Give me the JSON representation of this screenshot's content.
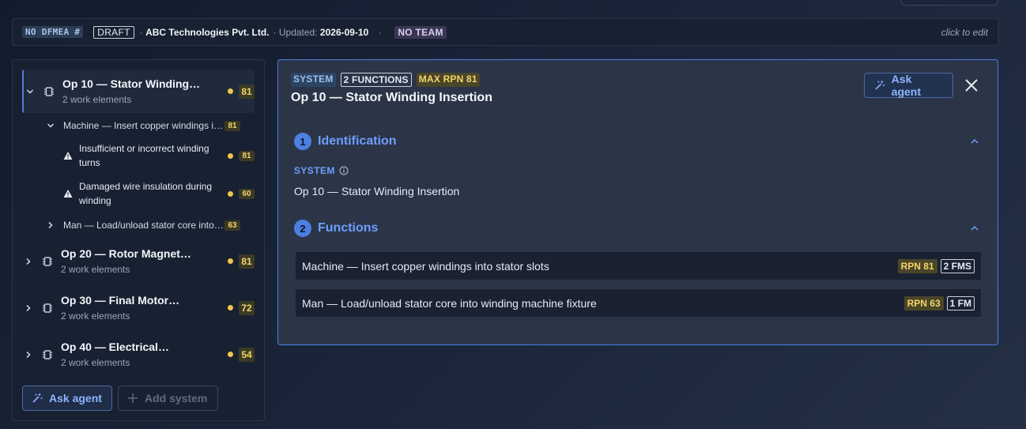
{
  "header": {
    "dfmea_tag": "NO DFMEA #",
    "status": "DRAFT",
    "company_prefix": "·",
    "company": "ABC Technologies Pvt. Ltd.",
    "updated_prefix": "· Updated:",
    "updated_date": "2026-09-10",
    "separator": "·",
    "team": "NO TEAM",
    "edit_hint": "click to edit"
  },
  "tree": {
    "systems": [
      {
        "title": "Op 10 — Stator Winding…",
        "subtitle": "2 work elements",
        "rpn": "81",
        "functions": [
          {
            "label": "Machine — Insert copper windings i…",
            "rpn": "81",
            "failure_modes": [
              {
                "label": "Insufficient or incorrect winding turns",
                "rpn": "81"
              },
              {
                "label": "Damaged wire insulation during winding",
                "rpn": "60"
              }
            ]
          },
          {
            "label": "Man — Load/unload stator core into…",
            "rpn": "63"
          }
        ]
      },
      {
        "title": "Op 20 — Rotor Magnet…",
        "subtitle": "2 work elements",
        "rpn": "81"
      },
      {
        "title": "Op 30 — Final Motor…",
        "subtitle": "2 work elements",
        "rpn": "72"
      },
      {
        "title": "Op 40 — Electrical…",
        "subtitle": "2 work elements",
        "rpn": "54"
      }
    ],
    "ask_agent_label": "Ask agent",
    "add_system_label": "Add system"
  },
  "detail": {
    "badges": {
      "type": "SYSTEM",
      "functions": "2 FUNCTIONS",
      "max_rpn": "MAX RPN 81"
    },
    "title": "Op 10 — Stator Winding Insertion",
    "ask_agent_label": "Ask agent",
    "sections": [
      {
        "num": "1",
        "title": "Identification"
      },
      {
        "num": "2",
        "title": "Functions"
      }
    ],
    "identification": {
      "field_label": "SYSTEM",
      "field_value": "Op 10 — Stator Winding Insertion"
    },
    "functions": [
      {
        "label": "Machine — Insert copper windings into stator slots",
        "rpn": "RPN 81",
        "fms": "2 FMS"
      },
      {
        "label": "Man — Load/unload stator core into winding machine fixture",
        "rpn": "RPN 63",
        "fms": "1 FM"
      }
    ]
  },
  "colors": {
    "accent": "#4c7fe0",
    "rpn_yellow": "#f3d46a",
    "rpn_dot": "#f0c64a"
  }
}
